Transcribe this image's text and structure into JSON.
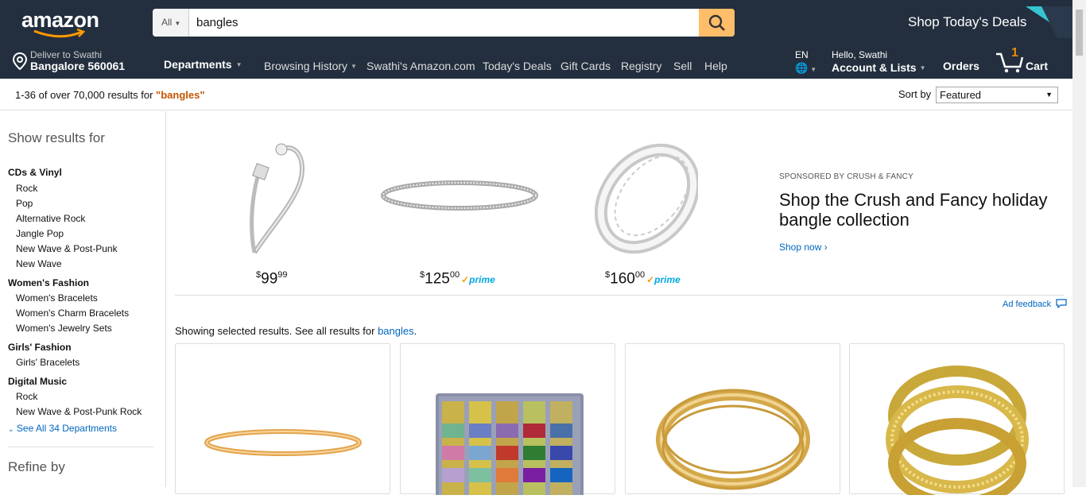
{
  "nav": {
    "logo": "amazon",
    "search": {
      "category": "All",
      "value": "bangles"
    },
    "deals_banner": "Shop Today's Deals",
    "deliver": {
      "line1": "Deliver to Swathi",
      "line2": "Bangalore 560061"
    },
    "departments": "Departments",
    "links": [
      "Browsing History",
      "Swathi's Amazon.com",
      "Today's Deals",
      "Gift Cards",
      "Registry",
      "Sell",
      "Help"
    ],
    "language": "EN",
    "account": {
      "greeting": "Hello, Swathi",
      "label": "Account & Lists"
    },
    "orders": "Orders",
    "cart": {
      "count": "1",
      "label": "Cart"
    }
  },
  "results": {
    "prefix": "1-36 of over 70,000 results for ",
    "query": "\"bangles\"",
    "sort_label": "Sort by",
    "sort_value": "Featured"
  },
  "sidebar": {
    "heading": "Show results for",
    "groups": [
      {
        "title": "CDs & Vinyl",
        "items": [
          "Rock",
          "Pop",
          "Alternative Rock",
          "Jangle Pop",
          "New Wave & Post-Punk",
          "New Wave"
        ]
      },
      {
        "title": "Women's Fashion",
        "items": [
          "Women's Bracelets",
          "Women's Charm Bracelets",
          "Women's Jewelry Sets"
        ]
      },
      {
        "title": "Girls' Fashion",
        "items": [
          "Girls' Bracelets"
        ]
      },
      {
        "title": "Digital Music",
        "items": [
          "Rock",
          "New Wave & Post-Punk Rock"
        ]
      }
    ],
    "see_all": "See All 34 Departments",
    "refine": "Refine by"
  },
  "sponsored": {
    "products": [
      {
        "dollars": "99",
        "cents": "99",
        "prime": false
      },
      {
        "dollars": "125",
        "cents": "00",
        "prime": true
      },
      {
        "dollars": "160",
        "cents": "00",
        "prime": true
      }
    ],
    "currency": "$",
    "prime_label": "prime",
    "label": "SPONSORED BY CRUSH & FANCY",
    "headline": "Shop the Crush and Fancy holiday bangle collection",
    "shop_now": "Shop now ›",
    "ad_feedback": "Ad feedback"
  },
  "showing": {
    "text": "Showing selected results. See all results for ",
    "link": "bangles",
    "end": "."
  },
  "colors": {
    "nav": "#232f3e",
    "search_button": "#febd69",
    "link": "#0066c0",
    "query": "#c45500",
    "prime": "#00a8e1"
  }
}
